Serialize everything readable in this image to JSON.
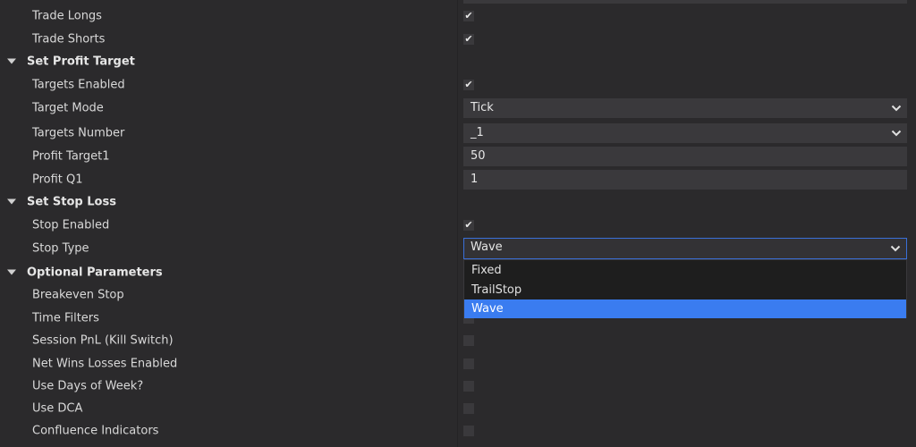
{
  "sections": {
    "general": {
      "trade_longs": {
        "label": "Trade Longs",
        "checked": true
      },
      "trade_shorts": {
        "label": "Trade Shorts",
        "checked": true
      }
    },
    "profit_target": {
      "title": "Set Profit Target",
      "targets_enabled": {
        "label": "Targets Enabled",
        "checked": true
      },
      "target_mode": {
        "label": "Target Mode",
        "value": "Tick"
      },
      "targets_number": {
        "label": "Targets Number",
        "value": "_1"
      },
      "profit_target1": {
        "label": "Profit Target1",
        "value": "50"
      },
      "profit_q1": {
        "label": "Profit Q1",
        "value": "1"
      }
    },
    "stop_loss": {
      "title": "Set Stop Loss",
      "stop_enabled": {
        "label": "Stop Enabled",
        "checked": true
      },
      "stop_type": {
        "label": "Stop Type",
        "value": "Wave",
        "options": [
          "Fixed",
          "TrailStop",
          "Wave"
        ],
        "selected_option": "Wave"
      }
    },
    "optional": {
      "title": "Optional Parameters",
      "items": [
        {
          "label": "Breakeven Stop",
          "checked": false
        },
        {
          "label": "Time Filters",
          "checked": false
        },
        {
          "label": "Session PnL (Kill Switch)",
          "checked": false
        },
        {
          "label": "Net Wins Losses Enabled",
          "checked": false
        },
        {
          "label": "Use Days of Week?",
          "checked": false
        },
        {
          "label": "Use DCA",
          "checked": false
        },
        {
          "label": "Confluence Indicators",
          "checked": false
        }
      ]
    }
  },
  "colors": {
    "background": "#2b2a2c",
    "field": "#3a393c",
    "dropdown_bg": "#1e1e1e",
    "selection": "#3a7cf0",
    "focus_border": "#3a6fd8"
  }
}
